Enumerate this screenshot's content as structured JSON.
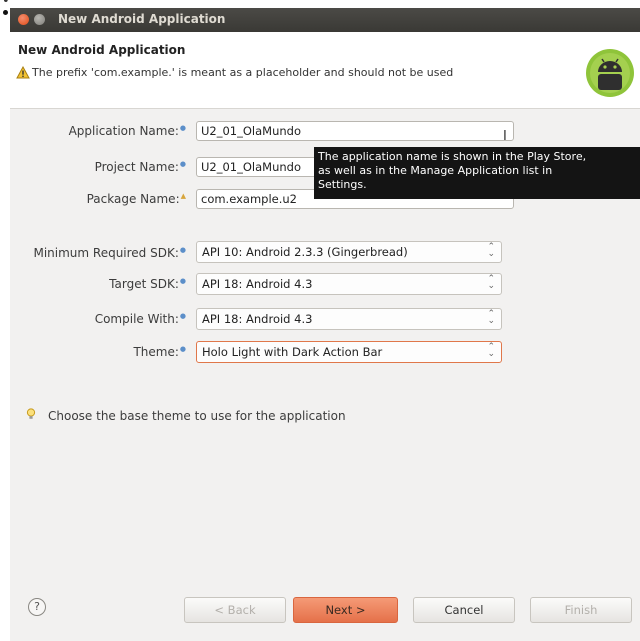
{
  "window": {
    "title": "New Android Application"
  },
  "header": {
    "title": "New Android Application",
    "warning": "The prefix 'com.example.' is meant as a placeholder and should not be used"
  },
  "form": {
    "app_name_label": "Application Name:",
    "app_name_value": "U2_01_OlaMundo",
    "project_name_label": "Project Name:",
    "project_name_value": "U2_01_OlaMundo",
    "package_name_label": "Package Name:",
    "package_name_value": "com.example.u2",
    "min_sdk_label": "Minimum Required SDK:",
    "min_sdk_value": "API 10: Android 2.3.3 (Gingerbread)",
    "target_sdk_label": "Target SDK:",
    "target_sdk_value": "API 18: Android 4.3",
    "compile_with_label": "Compile With:",
    "compile_with_value": "API 18: Android 4.3",
    "theme_label": "Theme:",
    "theme_value": "Holo Light with Dark Action Bar"
  },
  "tooltip": {
    "line1": "The application name is shown in the Play Store,",
    "line2": "as well as in the Manage Application list in",
    "line3": "Settings."
  },
  "hint": {
    "text": "Choose the base theme to use for the application"
  },
  "buttons": {
    "help": "?",
    "back": "< Back",
    "next": "Next >",
    "cancel": "Cancel",
    "finish": "Finish"
  },
  "icons": {
    "close": "close-icon",
    "minimize": "minimize-icon",
    "warning": "warning-icon",
    "android": "android-logo-icon",
    "lightbulb": "lightbulb-icon",
    "help": "help-icon",
    "required": "required-dot-icon"
  },
  "colors": {
    "accent": "#e5714a",
    "titlebar": "#3c3b37",
    "tooltip_bg": "#141414",
    "required_dot": "#5c8fc9"
  }
}
